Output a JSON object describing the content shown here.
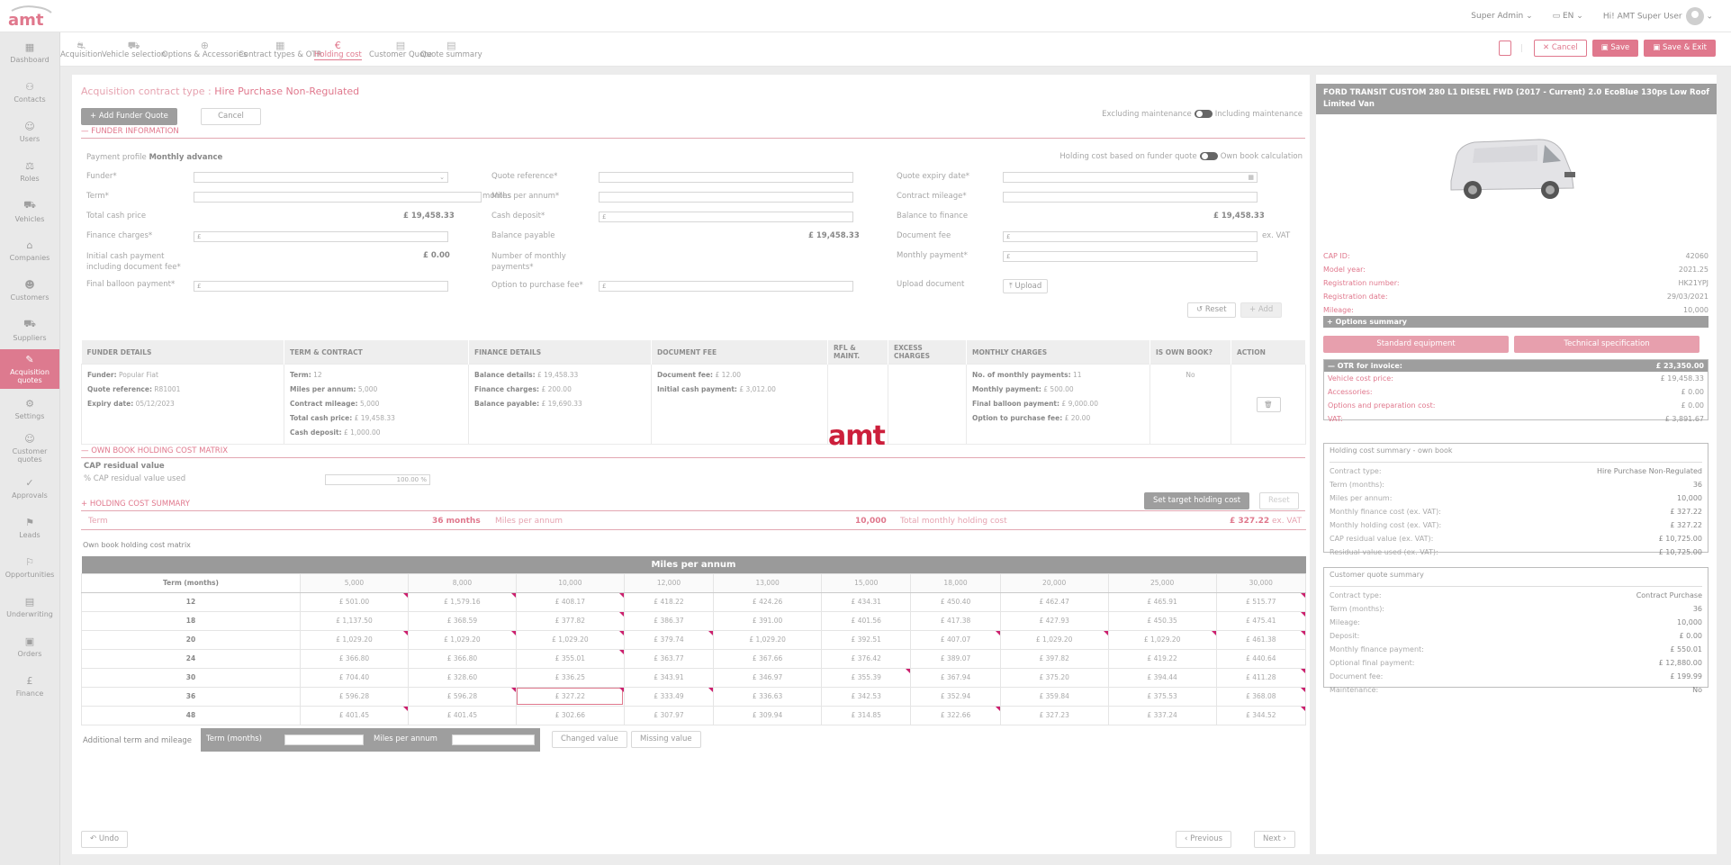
{
  "header": {
    "user_role": "Super Admin",
    "language": "EN",
    "greeting": "Hi! AMT Super User"
  },
  "sidebar": {
    "items": [
      {
        "icon": "dashboard-icon",
        "label": "Dashboard"
      },
      {
        "icon": "contacts-icon",
        "label": "Contacts"
      },
      {
        "icon": "users-icon",
        "label": "Users"
      },
      {
        "icon": "roles-icon",
        "label": "Roles"
      },
      {
        "icon": "vehicles-icon",
        "label": "Vehicles"
      },
      {
        "icon": "companies-icon",
        "label": "Companies"
      },
      {
        "icon": "customers-icon",
        "label": "Customers"
      },
      {
        "icon": "suppliers-icon",
        "label": "Suppliers"
      },
      {
        "icon": "acquisition-quotes-icon",
        "label": "Acquisition quotes",
        "active": true
      },
      {
        "icon": "settings-icon",
        "label": "Settings"
      },
      {
        "icon": "customer-quotes-icon",
        "label": "Customer quotes"
      },
      {
        "icon": "approvals-icon",
        "label": "Approvals"
      },
      {
        "icon": "leads-icon",
        "label": "Leads"
      },
      {
        "icon": "opportunities-icon",
        "label": "Opportunities"
      },
      {
        "icon": "underwriting-icon",
        "label": "Underwriting"
      },
      {
        "icon": "orders-icon",
        "label": "Orders"
      },
      {
        "icon": "finance-icon",
        "label": "Finance"
      }
    ]
  },
  "steps": [
    {
      "label": "Acquisition"
    },
    {
      "label": "Vehicle selection"
    },
    {
      "label": "Options & Accessories"
    },
    {
      "label": "Contract types & OTR"
    },
    {
      "label": "Holding cost",
      "active": true
    },
    {
      "label": "Customer Quote"
    },
    {
      "label": "Quote summary"
    }
  ],
  "actions": {
    "cancel": "Cancel",
    "save": "Save",
    "save_exit": "Save & Exit"
  },
  "page": {
    "contract_type_label": "Acquisition contract type :",
    "contract_type": "Hire Purchase Non-Regulated",
    "add_funder": "Add Funder Quote",
    "cancel": "Cancel",
    "excluding": "Excluding maintenance",
    "including": "Including maintenance",
    "funder_info": "FUNDER INFORMATION",
    "payment_profile_label": "Payment profile",
    "payment_profile": "Monthly advance",
    "holding_based": "Holding cost based on funder quote",
    "own_book": "Own book calculation"
  },
  "form": {
    "funder": "Funder*",
    "term": "Term*",
    "months": "months",
    "total_cash": "Total cash price",
    "total_cash_val": "£ 19,458.33",
    "finance_charges": "Finance charges*",
    "initial_cash": "Initial cash payment including document fee*",
    "initial_cash_val": "£ 0.00",
    "final_balloon": "Final balloon payment*",
    "quote_ref": "Quote reference*",
    "miles": "Miles per annum*",
    "cash_deposit": "Cash deposit*",
    "balance_payable": "Balance payable",
    "balance_payable_val": "£ 19,458.33",
    "num_payments": "Number of monthly payments*",
    "option_purchase": "Option to purchase fee*",
    "quote_expiry": "Quote expiry date*",
    "contract_mileage": "Contract mileage*",
    "balance_finance": "Balance to finance",
    "balance_finance_val": "£ 19,458.33",
    "document_fee": "Document fee",
    "ex_vat": "ex. VAT",
    "monthly_payment": "Monthly payment*",
    "upload_document": "Upload document",
    "upload": "Upload",
    "reset": "Reset",
    "add": "Add",
    "pound": "£"
  },
  "funder_table": {
    "headers": [
      "FUNDER DETAILS",
      "TERM & CONTRACT",
      "FINANCE DETAILS",
      "DOCUMENT FEE",
      "RFL & MAINT.",
      "EXCESS CHARGES",
      "MONTHLY CHARGES",
      "IS OWN BOOK?",
      "ACTION"
    ],
    "funder_details": [
      [
        "Funder:",
        "Popular Fiat"
      ],
      [
        "Quote reference:",
        "R81001"
      ],
      [
        "Expiry date:",
        "05/12/2023"
      ]
    ],
    "term_contract": [
      [
        "Term:",
        "12"
      ],
      [
        "Miles per annum:",
        "5,000"
      ],
      [
        "Contract mileage:",
        "5,000"
      ],
      [
        "Total cash price:",
        "£ 19,458.33"
      ],
      [
        "Cash deposit:",
        "£ 1,000.00"
      ]
    ],
    "finance_details": [
      [
        "Balance details:",
        "£ 19,458.33"
      ],
      [
        "Finance charges:",
        "£ 200.00"
      ],
      [
        "Balance payable:",
        "£ 19,690.33"
      ]
    ],
    "document_fee": [
      [
        "Document fee:",
        "£ 12.00"
      ],
      [
        "Initial cash payment:",
        "£ 3,012.00"
      ]
    ],
    "monthly_charges": [
      [
        "No. of monthly payments:",
        "11"
      ],
      [
        "Monthly payment:",
        "£ 500.00"
      ],
      [
        "Final balloon payment:",
        "£ 9,000.00"
      ],
      [
        "Option to purchase fee:",
        "£ 20.00"
      ]
    ],
    "is_own_book": "No"
  },
  "ownbook": {
    "title": "OWN BOOK HOLDING COST MATRIX",
    "cap_residual": "CAP residual value",
    "cap_pct_label": "% CAP residual value used",
    "cap_pct": "100.00 %"
  },
  "summary": {
    "title": "HOLDING COST SUMMARY",
    "set_target": "Set target holding cost",
    "reset": "Reset",
    "term_label": "Term",
    "term_val": "36 months",
    "miles_label": "Miles per annum",
    "miles_val": "10,000",
    "total_label": "Total monthly holding cost",
    "total_val": "£ 327.22",
    "ex_vat": "ex. VAT"
  },
  "matrix": {
    "title": "Own book holding cost matrix",
    "header": "Miles per annum",
    "term_header": "Term (months)",
    "miles": [
      "5,000",
      "8,000",
      "10,000",
      "12,000",
      "13,000",
      "15,000",
      "18,000",
      "20,000",
      "25,000",
      "30,000"
    ],
    "rows": [
      {
        "term": "12",
        "vals": [
          "£ 501.00",
          "£ 1,579.16",
          "£ 408.17",
          "£ 418.22",
          "£ 424.26",
          "£ 434.31",
          "£ 450.40",
          "£ 462.47",
          "£ 465.91",
          "£ 515.77"
        ]
      },
      {
        "term": "18",
        "vals": [
          "£ 1,137.50",
          "£ 368.59",
          "£ 377.82",
          "£ 386.37",
          "£ 391.00",
          "£ 401.56",
          "£ 417.38",
          "£ 427.93",
          "£ 450.35",
          "£ 475.41"
        ]
      },
      {
        "term": "20",
        "vals": [
          "£ 1,029.20",
          "£ 1,029.20",
          "£ 1,029.20",
          "£ 379.74",
          "£ 1,029.20",
          "£ 392.51",
          "£ 407.07",
          "£ 1,029.20",
          "£ 1,029.20",
          "£ 461.38"
        ]
      },
      {
        "term": "24",
        "vals": [
          "£ 366.80",
          "£ 366.80",
          "£ 355.01",
          "£ 363.77",
          "£ 367.66",
          "£ 376.42",
          "£ 389.07",
          "£ 397.82",
          "£ 419.22",
          "£ 440.64"
        ]
      },
      {
        "term": "30",
        "vals": [
          "£ 704.40",
          "£ 328.60",
          "£ 336.25",
          "£ 343.91",
          "£ 346.97",
          "£ 355.39",
          "£ 367.94",
          "£ 375.20",
          "£ 394.44",
          "£ 411.28"
        ]
      },
      {
        "term": "36",
        "vals": [
          "£ 596.28",
          "£ 596.28",
          "£ 327.22",
          "£ 333.49",
          "£ 336.63",
          "£ 342.53",
          "£ 352.94",
          "£ 359.84",
          "£ 375.53",
          "£ 368.08"
        ]
      },
      {
        "term": "48",
        "vals": [
          "£ 401.45",
          "£ 401.45",
          "£ 302.66",
          "£ 307.97",
          "£ 309.94",
          "£ 314.85",
          "£ 322.66",
          "£ 327.23",
          "£ 337.24",
          "£ 344.52"
        ]
      }
    ]
  },
  "additional": {
    "label": "Additional term and mileage",
    "term": "Term (months)",
    "miles": "Miles per annum",
    "changed": "Changed value",
    "missing": "Missing value"
  },
  "footer": {
    "undo": "Undo",
    "previous": "Previous",
    "next": "Next"
  },
  "vehicle": {
    "title": "FORD TRANSIT CUSTOM 280 L1 DIESEL FWD (2017 - Current) 2.0 EcoBlue 130ps Low Roof Limited Van",
    "specs": [
      [
        "CAP ID:",
        "42060"
      ],
      [
        "Model year:",
        "2021.25"
      ],
      [
        "Registration number:",
        "HK21YPJ"
      ],
      [
        "Registration date:",
        "29/03/2021"
      ],
      [
        "Mileage:",
        "10,000"
      ]
    ],
    "options_summary": "Options summary",
    "standard_equipment": "Standard equipment",
    "technical_spec": "Technical specification",
    "otr_label": "OTR for invoice:",
    "otr_val": "£ 23,350.00",
    "otr_rows": [
      [
        "Vehicle cost price:",
        "£ 19,458.33"
      ],
      [
        "Accessories:",
        "£ 0.00"
      ],
      [
        "Options and preparation cost:",
        "£ 0.00"
      ],
      [
        "VAT:",
        "£ 3,891.67"
      ]
    ]
  },
  "holding_summary": {
    "title": "Holding cost summary - own book",
    "rows": [
      [
        "Contract type:",
        "Hire Purchase Non-Regulated"
      ],
      [
        "Term (months):",
        "36"
      ],
      [
        "Miles per annum:",
        "10,000"
      ],
      [
        "Monthly finance cost (ex. VAT):",
        "£ 327.22"
      ],
      [
        "Monthly holding cost (ex. VAT):",
        "£ 327.22"
      ],
      [
        "CAP residual value (ex. VAT):",
        "£ 10,725.00"
      ],
      [
        "Residual value used (ex. VAT):",
        "£ 10,725.00"
      ]
    ]
  },
  "customer_summary": {
    "title": "Customer quote summary",
    "rows": [
      [
        "Contract type:",
        "Contract Purchase"
      ],
      [
        "Term (months):",
        "36"
      ],
      [
        "Mileage:",
        "10,000"
      ],
      [
        "Deposit:",
        "£ 0.00"
      ],
      [
        "Monthly finance payment:",
        "£ 550.01"
      ],
      [
        "Optional final payment:",
        "£ 12,880.00"
      ],
      [
        "Document fee:",
        "£ 199.99"
      ],
      [
        "Maintenance:",
        "No"
      ]
    ]
  },
  "watermark": "amt",
  "colors": {
    "accent": "#e0788d",
    "brand": "#cc1f3b"
  }
}
